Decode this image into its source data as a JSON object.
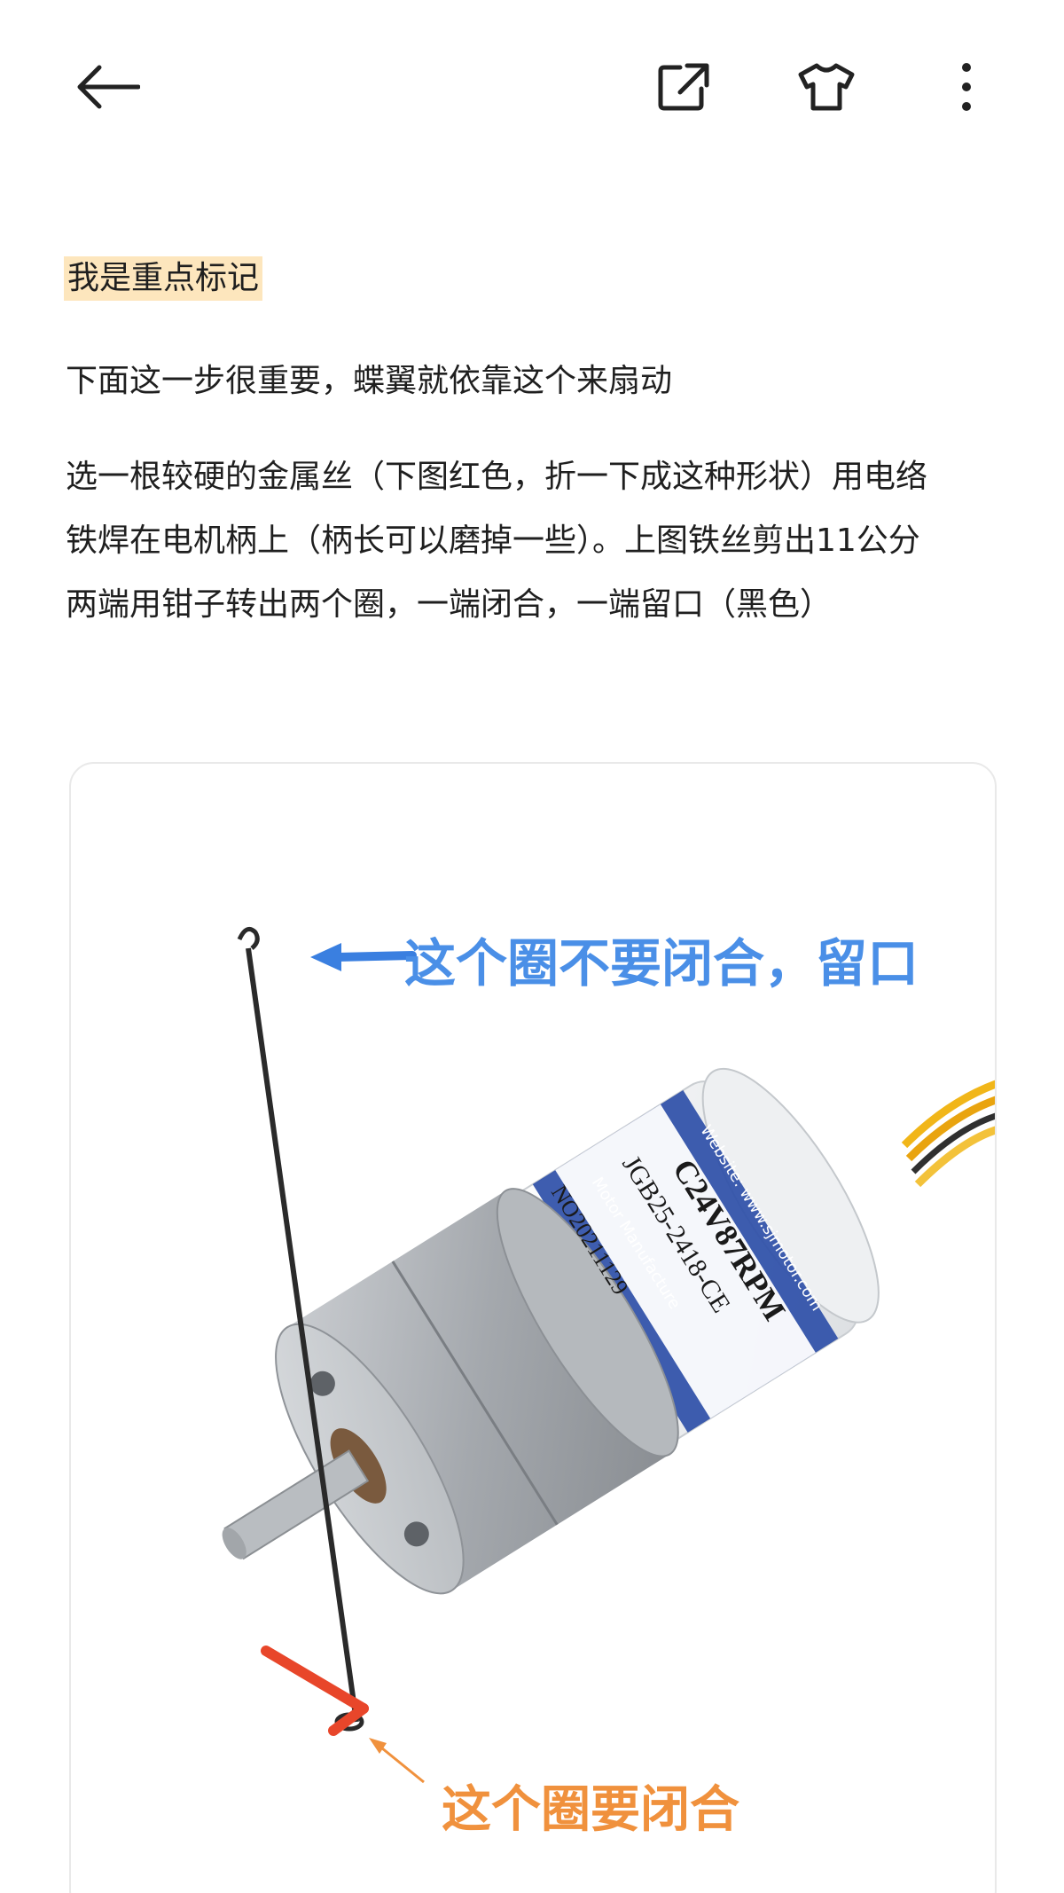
{
  "header": {
    "back_icon": "arrow-left-icon",
    "share_icon": "share-external-icon",
    "skin_icon": "tshirt-icon",
    "more_icon": "more-vertical-icon"
  },
  "content": {
    "highlight_text": "我是重点标记",
    "para1": "下面这一步很重要，蝶翼就依靠这个来扇动",
    "para2_line1": "选一根较硬的金属丝（下图红色，折一下成这种形状）用电络",
    "para2_line2": "铁焊在电机柄上（柄长可以磨掉一些）。上图铁丝剪出11公分",
    "para2_line3": "两端用钳子转出两个圈，一端闭合，一端留口（黑色）"
  },
  "image": {
    "annotation_open": "这个圈不要闭合，留口",
    "annotation_closed": "这个圈要闭合",
    "label_line1": "Website: www.sjmotor.com",
    "label_line2": "C24V87RPM",
    "label_line3": "JGB25-2418-CE",
    "label_line4": "Motor Manufacture",
    "label_line5": "NO20211129",
    "colors": {
      "annotation_open": "#4a8fe7",
      "annotation_closed": "#f0913d",
      "label_band": "#2e4fa8",
      "red_wire": "#e8462a"
    }
  }
}
